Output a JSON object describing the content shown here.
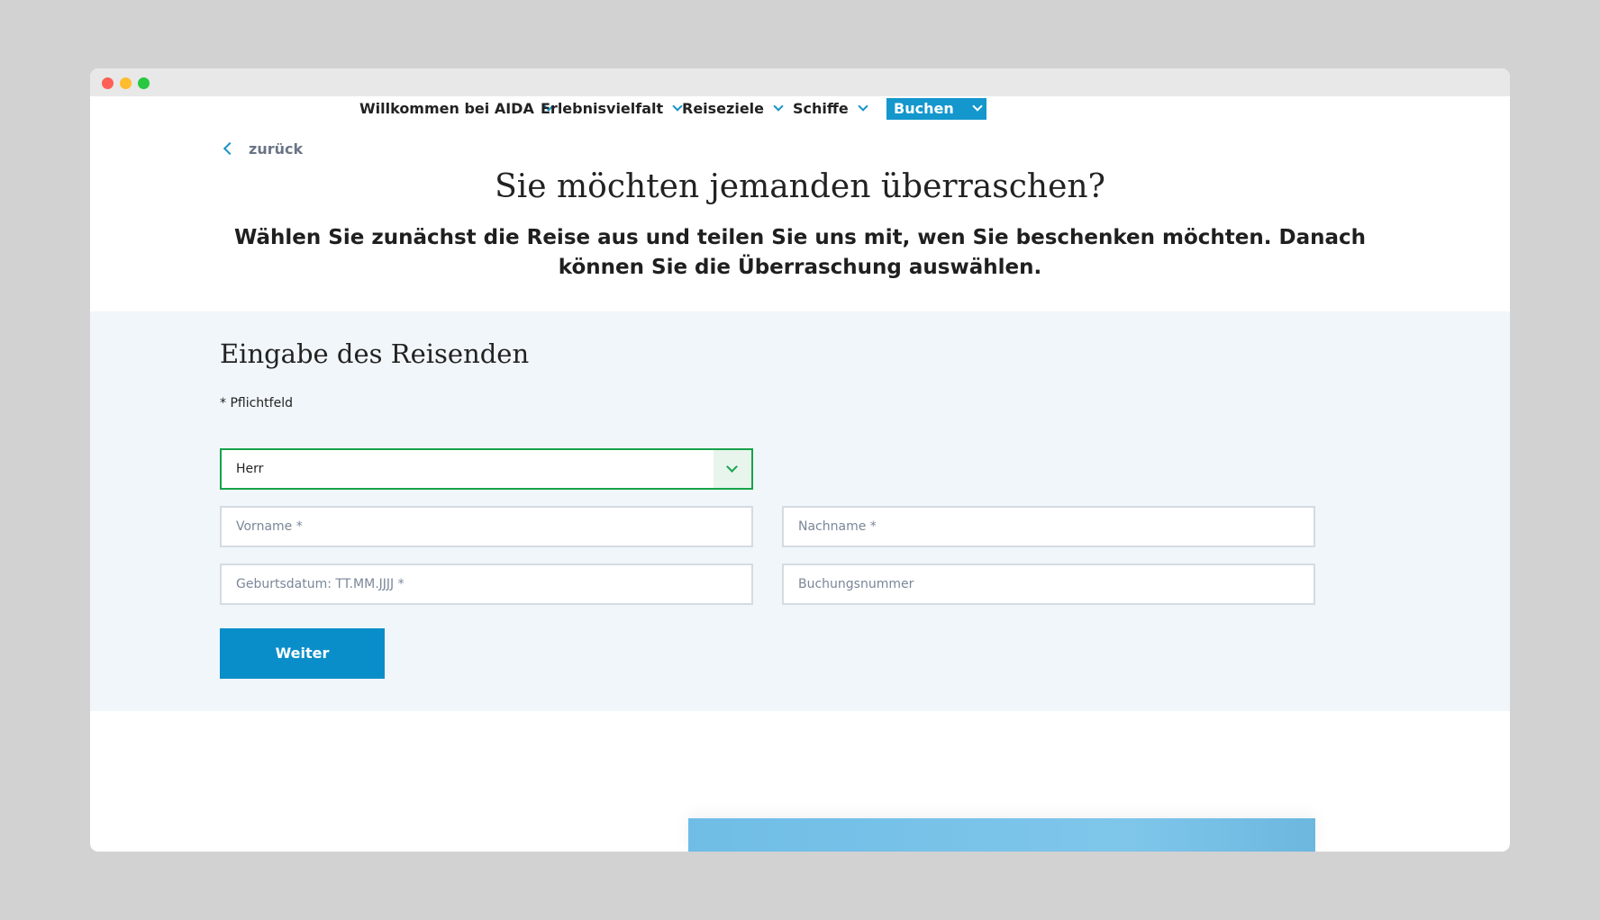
{
  "nav": {
    "items": [
      {
        "label": "Willkommen bei AIDA"
      },
      {
        "label": "Erlebnisvielfalt"
      },
      {
        "label": "Reiseziele"
      },
      {
        "label": "Schiffe"
      }
    ],
    "buchen": {
      "label": "Buchen"
    }
  },
  "back": {
    "label": "zurück"
  },
  "page": {
    "title": "Sie möchten jemanden überraschen?",
    "subtitle": "Wählen Sie zunächst die Reise aus und teilen Sie uns mit, wen Sie beschenken möchten. Danach können Sie die Überraschung auswählen."
  },
  "form": {
    "heading": "Eingabe des Reisenden",
    "required_note": "* Pflichtfeld",
    "salutation": {
      "selected": "Herr"
    },
    "first_name": {
      "placeholder": "Vorname *"
    },
    "last_name": {
      "placeholder": "Nachname *"
    },
    "birthdate": {
      "placeholder": "Geburtsdatum: TT.MM.JJJJ *"
    },
    "booking_number": {
      "placeholder": "Buchungsnummer"
    },
    "submit_label": "Weiter"
  },
  "colors": {
    "accent": "#0a8ec9",
    "valid_border": "#16a34a",
    "section_bg": "#f1f6fa"
  }
}
